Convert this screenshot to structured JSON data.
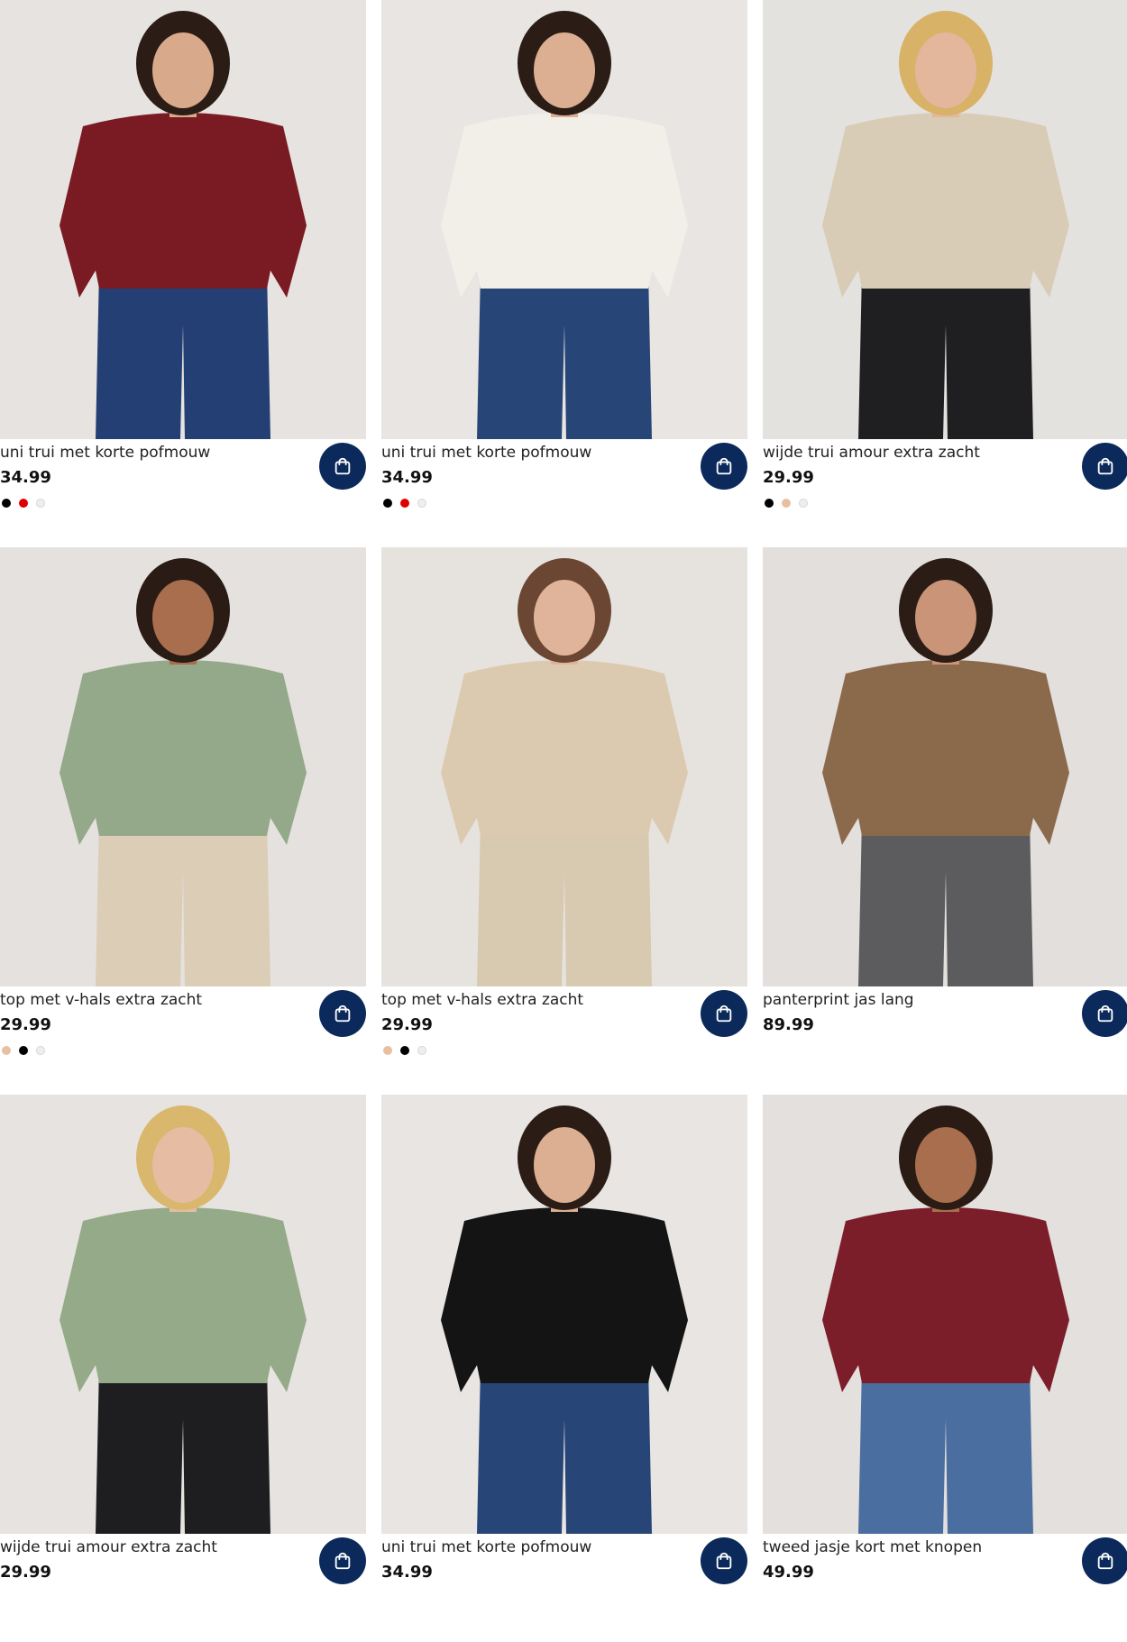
{
  "products": [
    {
      "name": "uni trui met korte pofmouw",
      "price": "34.99",
      "swatches": [
        "#000000",
        "#e10000",
        "#eeeeee"
      ],
      "photo": {
        "bg": "#e6e3e0",
        "hair": "#2b1d16",
        "skin": "#d9a98c",
        "top": "#7a1a22",
        "bottom": "#243f73"
      }
    },
    {
      "name": "uni trui met korte pofmouw",
      "price": "34.99",
      "swatches": [
        "#000000",
        "#e10000",
        "#eeeeee"
      ],
      "photo": {
        "bg": "#e8e5e2",
        "hair": "#2b1d16",
        "skin": "#dcae92",
        "top": "#f2efe8",
        "bottom": "#274677"
      }
    },
    {
      "name": "wijde trui amour extra zacht",
      "price": "29.99",
      "swatches": [
        "#000000",
        "#e8c0a0",
        "#eeeeee"
      ],
      "photo": {
        "bg": "#e4e2df",
        "hair": "#d8b266",
        "skin": "#e2b79c",
        "top": "#d8ccb6",
        "bottom": "#1f1f22"
      }
    },
    {
      "name": "top met v-hals extra zacht",
      "price": "29.99",
      "swatches": [
        "#e8c0a0",
        "#000000",
        "#eeeeee"
      ],
      "photo": {
        "bg": "#e4e1de",
        "hair": "#2a1c15",
        "skin": "#a86e4e",
        "top": "#94a989",
        "bottom": "#dccdb6"
      }
    },
    {
      "name": "top met v-hals extra zacht",
      "price": "29.99",
      "swatches": [
        "#e8c0a0",
        "#000000",
        "#eeeeee"
      ],
      "photo": {
        "bg": "#e6e3df",
        "hair": "#6b4632",
        "skin": "#e0b49a",
        "top": "#dccab0",
        "bottom": "#d8c9b1"
      }
    },
    {
      "name": "panterprint jas lang",
      "price": "89.99",
      "swatches": [],
      "photo": {
        "bg": "#e2dfdc",
        "hair": "#2b1d16",
        "skin": "#c99478",
        "top": "#8b6a4c",
        "bottom": "#5c5c5f"
      }
    },
    {
      "name": "wijde trui amour extra zacht",
      "price": "29.99",
      "swatches": [],
      "photo": {
        "bg": "#e6e3e0",
        "hair": "#d9b76c",
        "skin": "#e6bca2",
        "top": "#95aa88",
        "bottom": "#1e1e21"
      }
    },
    {
      "name": "uni trui met korte pofmouw",
      "price": "34.99",
      "swatches": [],
      "photo": {
        "bg": "#e8e5e2",
        "hair": "#2b1d16",
        "skin": "#dcae92",
        "top": "#141414",
        "bottom": "#274677"
      }
    },
    {
      "name": "tweed jasje kort met knopen",
      "price": "49.99",
      "swatches": [],
      "photo": {
        "bg": "#e3e0dd",
        "hair": "#2a1c15",
        "skin": "#a86e4e",
        "top": "#7c1d2a",
        "bottom": "#4a6ea0"
      }
    }
  ],
  "icons": {
    "cart": "shopping-bag-icon"
  },
  "colors": {
    "cart_button": "#0b2a5b"
  }
}
